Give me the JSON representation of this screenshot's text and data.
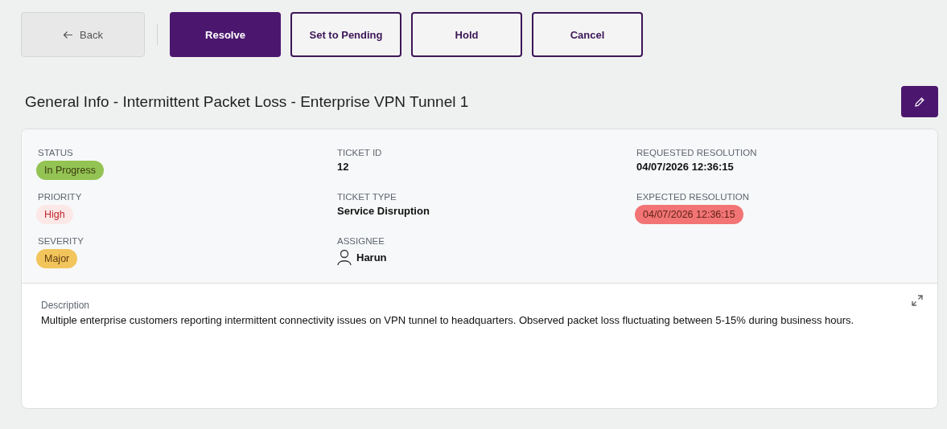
{
  "toolbar": {
    "back": {
      "label": "Back"
    },
    "actions": [
      {
        "label": "Resolve",
        "kind": "primary"
      },
      {
        "label": "Set to Pending",
        "kind": "outline"
      },
      {
        "label": "Hold",
        "kind": "outline"
      },
      {
        "label": "Cancel",
        "kind": "outline"
      }
    ]
  },
  "title": "General Info - Intermittent Packet Loss - Enterprise VPN Tunnel 1",
  "columns": [
    [
      {
        "label": "STATUS",
        "value": "In Progress",
        "kind": "badge",
        "color": "#93c353"
      },
      {
        "label": "PRIORITY",
        "value": "High",
        "kind": "badge",
        "color": "#fde8e8"
      },
      {
        "label": "SEVERITY",
        "value": "Major",
        "kind": "badge",
        "color": "#f2c55c"
      }
    ],
    [
      {
        "label": "TICKET ID",
        "value": "12",
        "kind": "text"
      },
      {
        "label": "TICKET TYPE",
        "value": "Service Disruption",
        "kind": "text"
      },
      {
        "label": "ASSIGNEE",
        "value": "Harun",
        "kind": "user"
      }
    ],
    [
      {
        "label": "REQUESTED RESOLUTION",
        "value": "04/07/2026 12:36:15",
        "kind": "text"
      },
      {
        "label": "EXPECTED RESOLUTION",
        "value": "04/07/2026 12:36:15",
        "kind": "badge",
        "color": "#f27474"
      }
    ]
  ],
  "description": {
    "label": "Description",
    "text": "Multiple enterprise customers reporting intermittent connectivity issues on VPN tunnel to headquarters. Observed packet loss fluctuating between 5-15% during business hours."
  }
}
